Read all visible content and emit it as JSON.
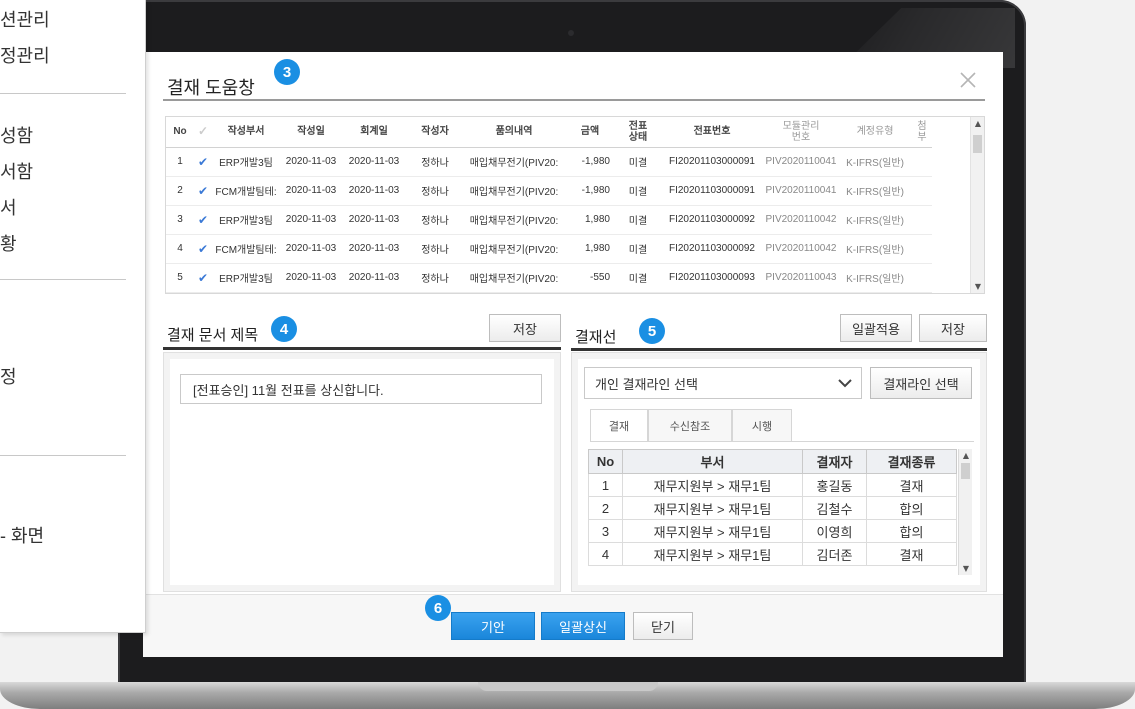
{
  "side_menu": {
    "items": [
      "션관리",
      "정관리",
      "성함",
      "서함",
      "서",
      "황",
      "정",
      "- 화면"
    ]
  },
  "dialog": {
    "title": "결재 도움창",
    "badges": {
      "title": "3",
      "doc_title": "4",
      "approval_line": "5",
      "actions": "6"
    },
    "grid": {
      "columns": [
        "No",
        "작성부서",
        "작성일",
        "회계일",
        "작성자",
        "품의내역",
        "금액",
        "전표\n상태",
        "전표번호",
        "모듈관리\n번호",
        "계정유형",
        "첨\n부"
      ],
      "rows": [
        {
          "no": "1",
          "checked": true,
          "dept": "ERP개발3팀",
          "written": "2020-11-03",
          "acct_date": "2020-11-03",
          "author": "정하나",
          "desc": "매입채무전기(PIV20:",
          "amount": "-1,980",
          "status": "미결",
          "slip_no": "FI20201103000091",
          "module_no": "PIV2020110041",
          "acct_type": "K-IFRS(일반)"
        },
        {
          "no": "2",
          "checked": true,
          "dept": "FCM개발팀테:",
          "written": "2020-11-03",
          "acct_date": "2020-11-03",
          "author": "정하나",
          "desc": "매입채무전기(PIV20:",
          "amount": "-1,980",
          "status": "미결",
          "slip_no": "FI20201103000091",
          "module_no": "PIV2020110041",
          "acct_type": "K-IFRS(일반)"
        },
        {
          "no": "3",
          "checked": true,
          "dept": "ERP개발3팀",
          "written": "2020-11-03",
          "acct_date": "2020-11-03",
          "author": "정하나",
          "desc": "매입채무전기(PIV20:",
          "amount": "1,980",
          "status": "미결",
          "slip_no": "FI20201103000092",
          "module_no": "PIV2020110042",
          "acct_type": "K-IFRS(일반)"
        },
        {
          "no": "4",
          "checked": true,
          "dept": "FCM개발팀테:",
          "written": "2020-11-03",
          "acct_date": "2020-11-03",
          "author": "정하나",
          "desc": "매입채무전기(PIV20:",
          "amount": "1,980",
          "status": "미결",
          "slip_no": "FI20201103000092",
          "module_no": "PIV2020110042",
          "acct_type": "K-IFRS(일반)"
        },
        {
          "no": "5",
          "checked": true,
          "dept": "ERP개발3팀",
          "written": "2020-11-03",
          "acct_date": "2020-11-03",
          "author": "정하나",
          "desc": "매입채무전기(PIV20:",
          "amount": "-550",
          "status": "미결",
          "slip_no": "FI20201103000093",
          "module_no": "PIV2020110043",
          "acct_type": "K-IFRS(일반)"
        }
      ]
    },
    "doc_title_section": {
      "label": "결재 문서 제목",
      "save_label": "저장",
      "title_value": "[전표승인] 11월 전표를 상신합니다."
    },
    "approval_section": {
      "label": "결재선",
      "bulk_apply_label": "일괄적용",
      "save_label": "저장",
      "select_value": "개인 결재라인 선택",
      "select_button_label": "결재라인 선택",
      "tabs": [
        "결재",
        "수신참조",
        "시행"
      ],
      "columns": [
        "No",
        "부서",
        "결재자",
        "결재종류"
      ],
      "rows": [
        {
          "no": "1",
          "dept": "재무지원부 > 재무1팀",
          "approver": "홍길동",
          "type": "결재"
        },
        {
          "no": "2",
          "dept": "재무지원부 > 재무1팀",
          "approver": "김철수",
          "type": "합의"
        },
        {
          "no": "3",
          "dept": "재무지원부 > 재무1팀",
          "approver": "이영희",
          "type": "합의"
        },
        {
          "no": "4",
          "dept": "재무지원부 > 재무1팀",
          "approver": "김더존",
          "type": "결재"
        }
      ]
    },
    "actions": {
      "draft_label": "기안",
      "bulk_submit_label": "일괄상신",
      "close_label": "닫기"
    }
  },
  "colors": {
    "accent_blue": "#1a8fe3",
    "check_blue": "#3a79d6",
    "laptop_frame": "#1c1c1e"
  }
}
